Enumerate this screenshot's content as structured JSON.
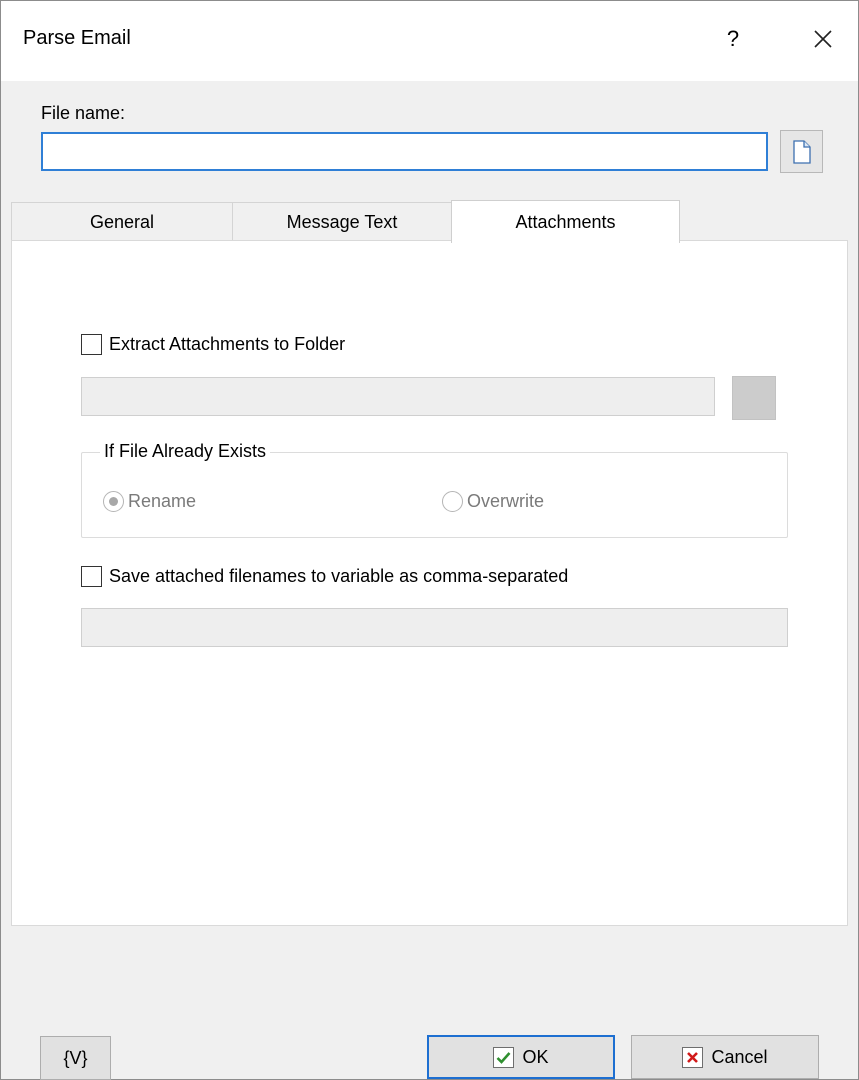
{
  "window": {
    "title": "Parse Email",
    "help_label": "?"
  },
  "file": {
    "label": "File name:",
    "value": "",
    "placeholder": ""
  },
  "tabs": [
    {
      "label": "General",
      "active": false
    },
    {
      "label": "Message Text",
      "active": false
    },
    {
      "label": "Attachments",
      "active": true
    }
  ],
  "attachments": {
    "extract_checkbox": {
      "label": "Extract Attachments to Folder",
      "checked": false
    },
    "folder_value": "",
    "group_title": "If File Already Exists",
    "radio_rename": {
      "label": "Rename",
      "checked": true,
      "enabled": false
    },
    "radio_overwrite": {
      "label": "Overwrite",
      "checked": false,
      "enabled": false
    },
    "save_checkbox": {
      "label": "Save attached filenames to variable as comma-separated",
      "checked": false
    },
    "variable_value": ""
  },
  "footer": {
    "variables_button": "{V}",
    "ok_button": "OK",
    "cancel_button": "Cancel"
  },
  "colors": {
    "focus_border": "#2f7fd6",
    "ok_check": "#2f8f2f",
    "cancel_x": "#d11a1a"
  },
  "icons": {
    "browse": "document-icon",
    "ok": "checkmark-icon",
    "cancel": "x-icon",
    "close": "close-icon"
  }
}
